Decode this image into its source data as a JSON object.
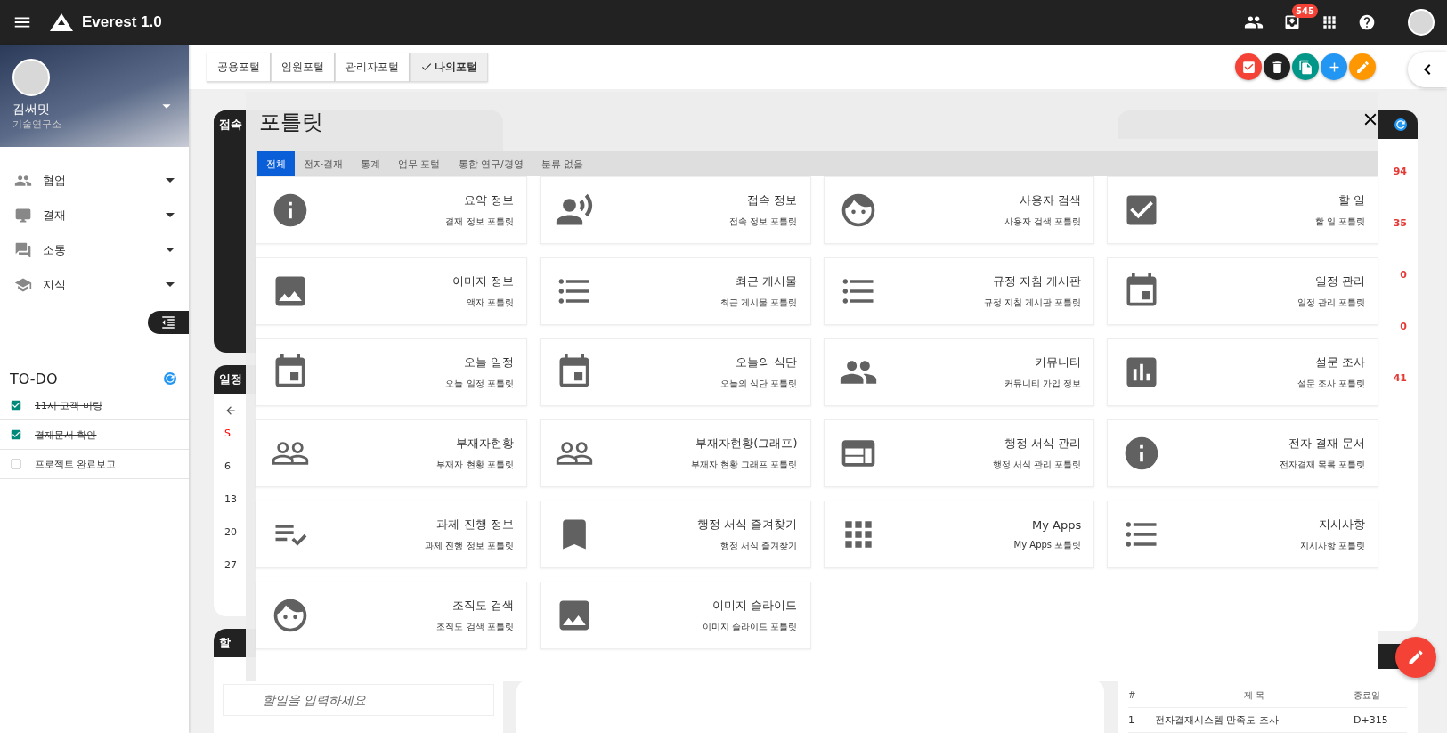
{
  "app": {
    "title": "Everest 1.0",
    "notification_count": "545"
  },
  "profile": {
    "name": "김써밋",
    "department": "기술연구소"
  },
  "menu": [
    {
      "label": "협업",
      "kind": "people"
    },
    {
      "label": "결재",
      "kind": "monitor"
    },
    {
      "label": "소통",
      "kind": "chat"
    },
    {
      "label": "지식",
      "kind": "school"
    }
  ],
  "todo": {
    "title": "TO-DO",
    "items": [
      {
        "label": "11시 고객 미팅",
        "checked": true
      },
      {
        "label": "결재문서 확인",
        "checked": true
      },
      {
        "label": "프로젝트 완료보고",
        "checked": false
      }
    ]
  },
  "portal_tabs": [
    {
      "label": "공용포털",
      "selected": false
    },
    {
      "label": "임원포털",
      "selected": false
    },
    {
      "label": "관리자포털",
      "selected": false
    },
    {
      "label": "나의포털",
      "selected": true
    }
  ],
  "actions": [
    {
      "kind": "check",
      "color": "#f44336"
    },
    {
      "kind": "delete",
      "color": "#212121"
    },
    {
      "kind": "copy",
      "color": "#009688"
    },
    {
      "kind": "add",
      "color": "#2196f3"
    },
    {
      "kind": "edit",
      "color": "#ff9800"
    }
  ],
  "background": {
    "card_titles": [
      "접속",
      "일정",
      "할"
    ],
    "calendar": [
      "S",
      "6",
      "13",
      "20",
      "27"
    ],
    "todo_placeholder": "할일을 입력하세요",
    "counts": [
      "94",
      "35",
      "0",
      "0",
      "41"
    ],
    "table": {
      "columns": [
        "#",
        "제 목",
        "종료일"
      ],
      "rows": [
        [
          "1",
          "전자결재시스템 만족도 조사",
          "D+315"
        ]
      ]
    }
  },
  "modal": {
    "title": "포틀릿",
    "tabs": [
      {
        "label": "전체",
        "selected": true
      },
      {
        "label": "전자결재",
        "selected": false
      },
      {
        "label": "통계",
        "selected": false
      },
      {
        "label": "업무 포털",
        "selected": false
      },
      {
        "label": "통합 연구/경영",
        "selected": false
      },
      {
        "label": "분류 없음",
        "selected": false
      }
    ],
    "portlets": [
      {
        "title": "요약 정보",
        "subtitle": "결재 정보 포틀릿",
        "kind": "info"
      },
      {
        "title": "접속 정보",
        "subtitle": "접속 정보 포틀릿",
        "kind": "voice"
      },
      {
        "title": "사용자 검색",
        "subtitle": "사용자 검색 포틀릿",
        "kind": "face"
      },
      {
        "title": "할 일",
        "subtitle": "할 일 포틀릿",
        "kind": "check"
      },
      {
        "title": "이미지 정보",
        "subtitle": "액자 포틀릿",
        "kind": "image"
      },
      {
        "title": "최근 게시물",
        "subtitle": "최근 게시물 포틀릿",
        "kind": "list"
      },
      {
        "title": "규정 지침 게시판",
        "subtitle": "규정 지침 게시판 포틀릿",
        "kind": "list"
      },
      {
        "title": "일정 관리",
        "subtitle": "일정 관리 포틀릿",
        "kind": "calendar"
      },
      {
        "title": "오늘 일정",
        "subtitle": "오늘 일정 포틀릿",
        "kind": "calendar"
      },
      {
        "title": "오늘의 식단",
        "subtitle": "오늘의 식단 포틀릿",
        "kind": "calendar"
      },
      {
        "title": "커뮤니티",
        "subtitle": "커뮤니티 가입 정보",
        "kind": "people"
      },
      {
        "title": "설문 조사",
        "subtitle": "설문 조사 포틀릿",
        "kind": "chart"
      },
      {
        "title": "부재자현황",
        "subtitle": "부재자 현황 포틀릿",
        "kind": "people_outline"
      },
      {
        "title": "부재자현황(그래프)",
        "subtitle": "부재자 현황 그래프 포틀릿",
        "kind": "people_outline"
      },
      {
        "title": "행정 서식 관리",
        "subtitle": "행정 서식 관리 포틀릿",
        "kind": "web"
      },
      {
        "title": "전자 결재 문서",
        "subtitle": "전자결재 목록 포틀릿",
        "kind": "info"
      },
      {
        "title": "과제 진행 정보",
        "subtitle": "과제 진행 정보 포틀릿",
        "kind": "checklist"
      },
      {
        "title": "행정 서식 즐겨찾기",
        "subtitle": "행정 서식 즐겨찾기",
        "kind": "bookmark"
      },
      {
        "title": "My Apps",
        "subtitle": "My Apps 포틀릿",
        "kind": "grid"
      },
      {
        "title": "지시사항",
        "subtitle": "지시사항 포틀릿",
        "kind": "list"
      },
      {
        "title": "조직도 검색",
        "subtitle": "조직도 검색 포틀릿",
        "kind": "face"
      },
      {
        "title": "이미지 슬라이드",
        "subtitle": "이미지 슬라이드 포틀릿",
        "kind": "image"
      }
    ]
  }
}
